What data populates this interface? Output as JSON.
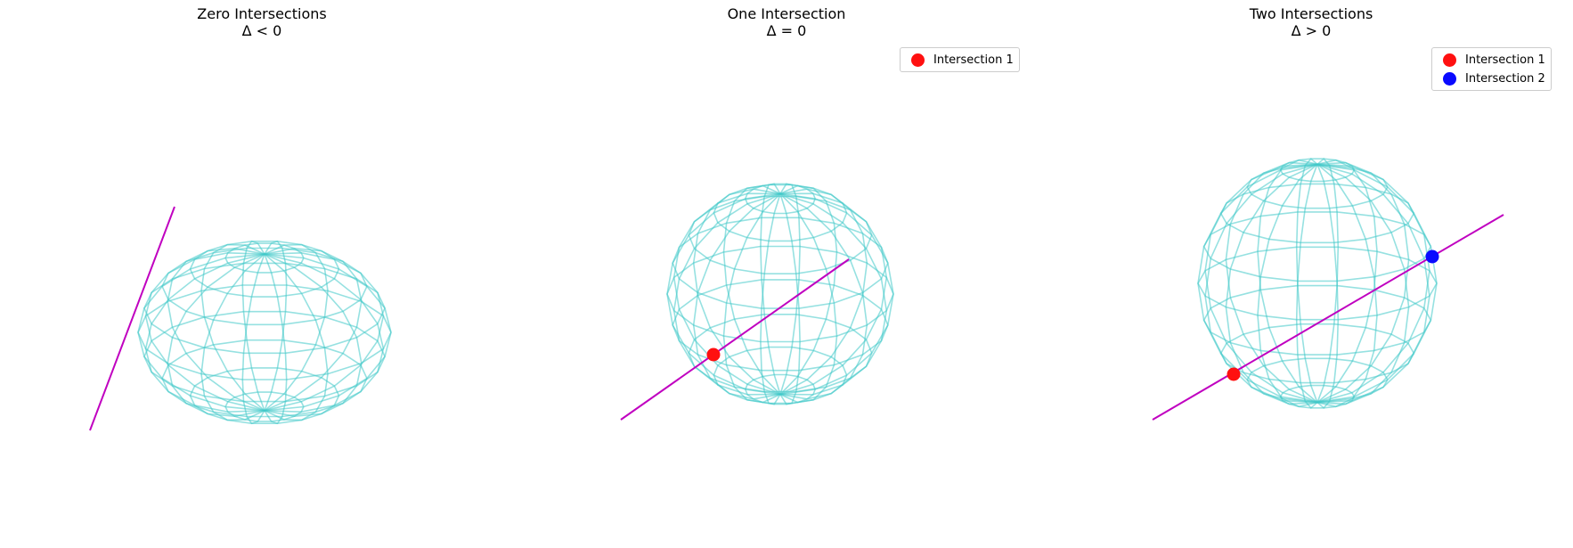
{
  "colors": {
    "sphere": "#40c8c8",
    "line": "#c000c0",
    "intersection_1": "#ff1010",
    "intersection_2": "#0a0aff"
  },
  "panels": [
    {
      "title": "Zero Intersections",
      "subtitle": "Δ < 0",
      "legend": []
    },
    {
      "title": "One Intersection",
      "subtitle": "Δ = 0",
      "legend": [
        {
          "label": "Intersection 1",
          "color": "#ff1010"
        }
      ]
    },
    {
      "title": "Two Intersections",
      "subtitle": "Δ > 0",
      "legend": [
        {
          "label": "Intersection 1",
          "color": "#ff1010"
        },
        {
          "label": "Intersection 2",
          "color": "#0a0aff"
        }
      ]
    }
  ]
}
